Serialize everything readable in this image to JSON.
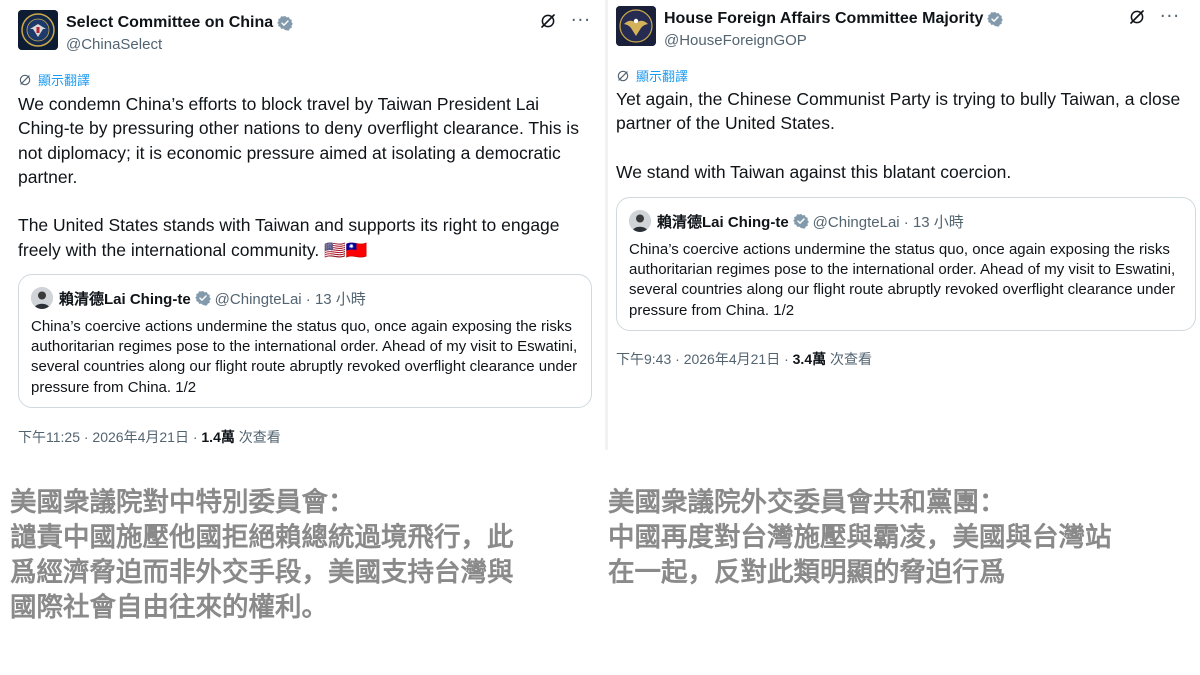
{
  "left_tweet": {
    "display_name": "Select Committee on China",
    "handle": "@ChinaSelect",
    "translate_label": "顯示翻譯",
    "body": "We condemn China’s efforts to block travel by Taiwan President Lai\nChing-te by pressuring other nations to deny overflight clearance. This is\nnot diplomacy; it is economic pressure aimed at isolating a democratic\npartner.\n\nThe United States stands with Taiwan and supports its right to engage\nfreely with the international community. 🇺🇸🇹🇼",
    "quote": {
      "display_name": "賴清德Lai Ching-te",
      "handle": "@ChingteLai · 13 小時",
      "text": "China’s coercive actions undermine the status quo, once again exposing the risks authoritarian regimes pose to the international order. Ahead of my visit to Eswatini, several countries along our flight route abruptly revoked overflight clearance under pressure from China. 1/2"
    },
    "meta": {
      "time": "下午11:25 · 2026年4月21日 · ",
      "views_count": "1.4萬",
      "views_label": " 次查看"
    }
  },
  "right_tweet": {
    "display_name": "House Foreign Affairs Committee Majority",
    "handle": "@HouseForeignGOP",
    "translate_label": "顯示翻譯",
    "body": "Yet again, the Chinese Communist Party is trying to bully Taiwan, a close\npartner of the United States.\n\nWe stand with Taiwan against this blatant coercion.",
    "quote": {
      "display_name": "賴清德Lai Ching-te",
      "handle": "@ChingteLai · 13 小時",
      "text": "China’s coercive actions undermine the status quo, once again exposing the risks authoritarian regimes pose to the international order. Ahead of my visit to Eswatini, several countries along our flight route abruptly revoked overflight clearance under pressure from China. 1/2"
    },
    "meta": {
      "time": "下午9:43 · 2026年4月21日 · ",
      "views_count": "3.4萬",
      "views_label": " 次查看"
    }
  },
  "captions": {
    "left": "美國衆議院對中特別委員會：\n譴責中國施壓他國拒絕賴總統過境飛行，此\n爲經濟脅迫而非外交手段，美國支持台灣與\n國際社會自由往來的權利。",
    "right": "美國衆議院外交委員會共和黨團：\n中國再度對台灣施壓與霸凌，美國與台灣站\n在一起，反對此類明顯的脅迫行爲"
  },
  "colors": {
    "link_blue": "#1d9bf0",
    "muted_text": "#536471",
    "caption_gray": "#8a8a8a",
    "border": "#cfd9de"
  },
  "icons": {
    "verified": "verified-badge-icon",
    "grok": "grok-icon",
    "more": "more-options-icon",
    "translate": "translate-icon"
  }
}
